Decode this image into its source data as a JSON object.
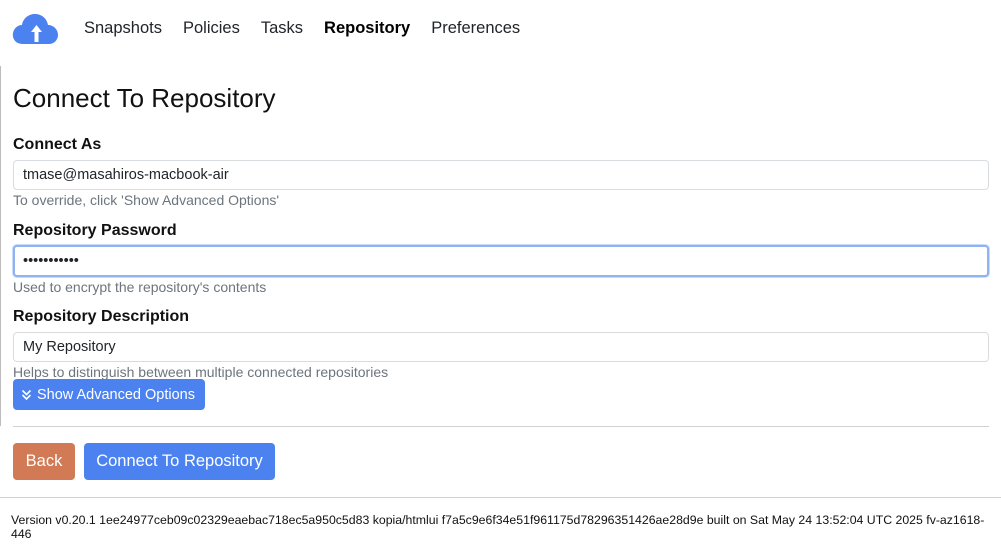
{
  "nav": {
    "logo_icon": "cloud-upload-icon",
    "links": [
      {
        "label": "Snapshots",
        "active": false
      },
      {
        "label": "Policies",
        "active": false
      },
      {
        "label": "Tasks",
        "active": false
      },
      {
        "label": "Repository",
        "active": true
      },
      {
        "label": "Preferences",
        "active": false
      }
    ]
  },
  "page": {
    "title": "Connect To Repository"
  },
  "form": {
    "connect_as": {
      "label": "Connect As",
      "value": "tmase@masahiros-macbook-air",
      "help": "To override, click 'Show Advanced Options'"
    },
    "password": {
      "label": "Repository Password",
      "value": "•••••••••••",
      "help": "Used to encrypt the repository's contents"
    },
    "description": {
      "label": "Repository Description",
      "value": "My Repository",
      "help": "Helps to distinguish between multiple connected repositories"
    },
    "advanced_button": {
      "label": "Show Advanced Options",
      "icon": "double-chevron-down-icon"
    },
    "back_button": "Back",
    "connect_button": "Connect To Repository"
  },
  "footer": {
    "version_text": "Version v0.20.1 1ee24977ceb09c02329eaebac718ec5a950c5d83 kopia/htmlui f7a5c9e6f34e51f961175d78296351426ae28d9e built on Sat May 24 13:52:04 UTC 2025 fv-az1618-446"
  },
  "colors": {
    "primary": "#4b82ef",
    "back": "#d27a55",
    "logo": "#4b82ef"
  }
}
